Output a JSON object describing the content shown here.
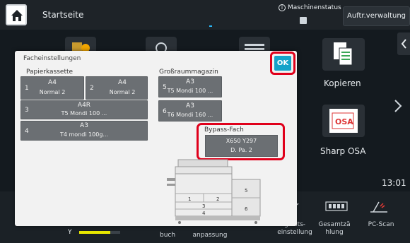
{
  "topbar": {
    "title": "Startseite",
    "machine_status": "Maschinenstatus",
    "job_status_button": "Auftr.verwaltung"
  },
  "home": {
    "apps": [
      {
        "label": "Kopieren",
        "icon": "copy-icon"
      },
      {
        "label": "Sharp OSA",
        "icon": "sharp-osa-icon"
      }
    ],
    "clock": "13:01",
    "toner_label": "Y",
    "toner_level": 0.75,
    "dock": [
      {
        "label": "buch"
      },
      {
        "label": "anpassung"
      },
      {
        "label": "gkeits-\neinstellung"
      },
      {
        "label": "Gesamtzä\nhlung"
      },
      {
        "label": "PC-Scan"
      }
    ]
  },
  "dialog": {
    "title": "Facheinstellungen",
    "ok_label": "OK",
    "cassette_section": "Papierkassette",
    "lcc_section": "Großraummagazin",
    "bypass_section": "Bypass-Fach",
    "trays": [
      {
        "num": "1",
        "size": "A4",
        "type": "Normal 2"
      },
      {
        "num": "2",
        "size": "A4",
        "type": "Normal 2"
      },
      {
        "num": "3",
        "size": "A4R",
        "type": "T5 Mondi 100 ..."
      },
      {
        "num": "4",
        "size": "A3",
        "type": "T4 mondi 100g..."
      },
      {
        "num": "5",
        "size": "A3",
        "type": "T5 Mondi 100 ..."
      },
      {
        "num": "6",
        "size": "A3",
        "type": "T6 Mondi 160 ..."
      }
    ],
    "bypass": {
      "size": "X650 Y297",
      "type": "D. Pa. 2"
    },
    "printer_labels": [
      "1",
      "2",
      "3",
      "4",
      "5",
      "6"
    ]
  },
  "colors": {
    "accent_ok": "#15a3c9",
    "highlight": "#e0001b",
    "tray_bg": "#6b6f73",
    "toner_yellow": "#e6e600"
  }
}
